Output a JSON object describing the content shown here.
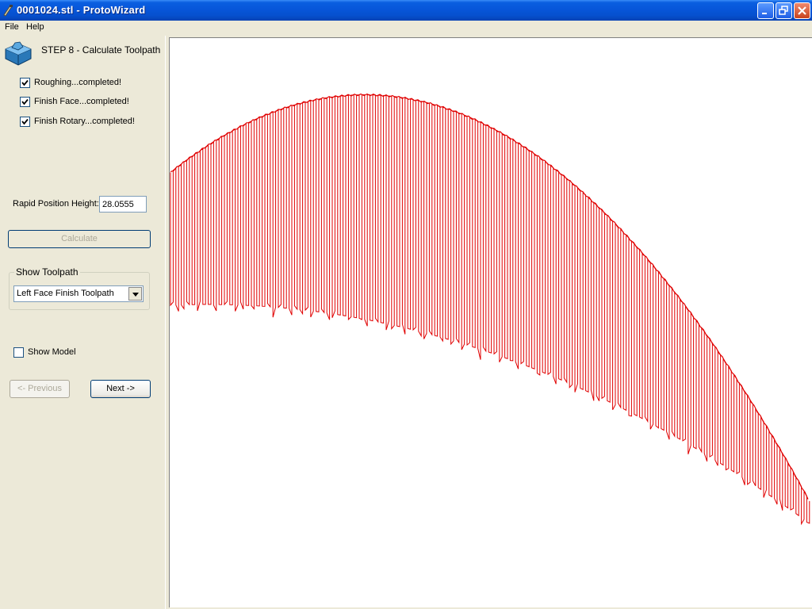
{
  "window": {
    "title": "0001024.stl - ProtoWizard"
  },
  "menu": {
    "items": [
      "File",
      "Help"
    ]
  },
  "step": {
    "title": "STEP 8 - Calculate Toolpath"
  },
  "checks": [
    {
      "label": "Roughing...completed!",
      "checked": true
    },
    {
      "label": "Finish Face...completed!",
      "checked": true
    },
    {
      "label": "Finish Rotary...completed!",
      "checked": true
    }
  ],
  "rapid": {
    "label": "Rapid Position Height:",
    "value": "28.0555"
  },
  "calculate": {
    "label": "Calculate"
  },
  "toolpath": {
    "group_label": "Show Toolpath",
    "selected": "Left Face Finish Toolpath"
  },
  "show_model": {
    "label": "Show Model",
    "checked": false
  },
  "nav": {
    "previous_label": "<- Previous",
    "next_label": "Next ->"
  },
  "colors": {
    "toolpath": "#E00000",
    "titlebar": "#0756D9",
    "panel": "#ECE9D8"
  },
  "icons": {
    "app": "app-icon",
    "step": "step-icon",
    "minimize": "minimize-icon",
    "maximize": "restore-icon",
    "close": "close-icon"
  }
}
